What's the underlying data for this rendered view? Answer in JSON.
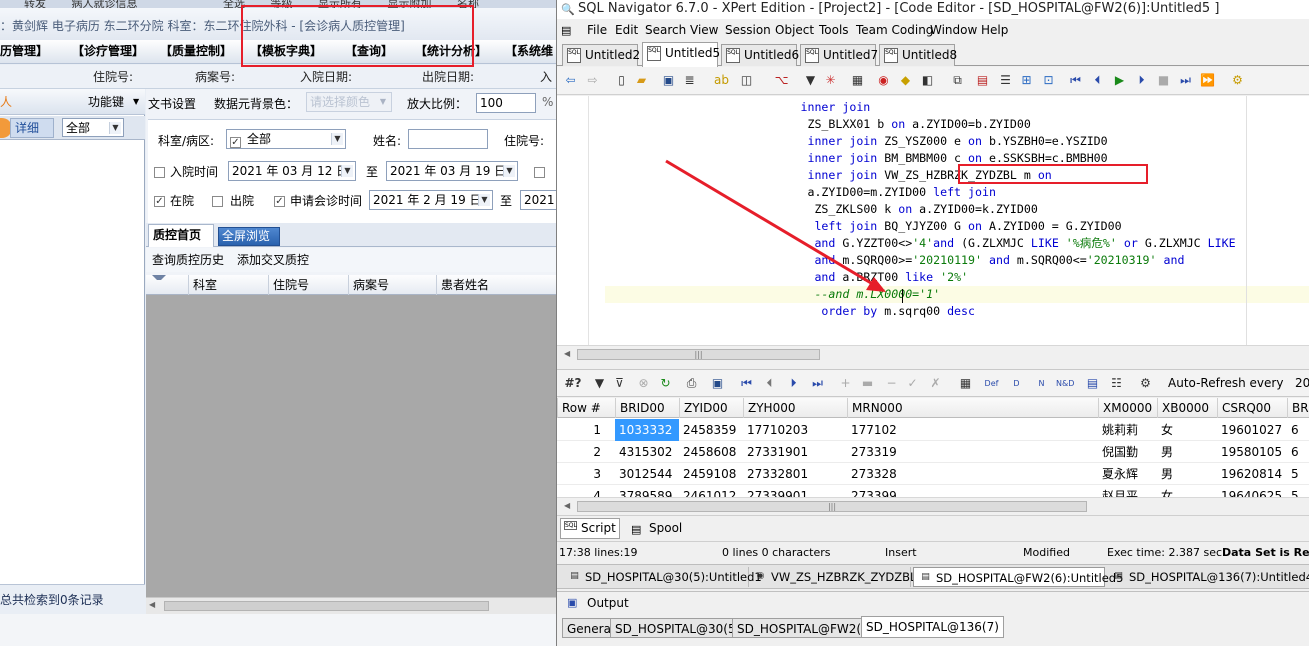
{
  "left_app": {
    "top_strip": [
      "转发",
      "病人就诊信息",
      "全选",
      "等级",
      "显示所有",
      "显示附加",
      "名称"
    ],
    "info": "：黄剑辉 电子病历  东二环分院  科室：东二环住院外科 - [会诊病人质控管理]",
    "menu": [
      "历管理】",
      "【诊疗管理】",
      "【质量控制】",
      "【模板字典】",
      "【查询】",
      "【统计分析】",
      "【系统维"
    ],
    "header_fields": [
      "住院号:",
      "病案号:",
      "入院日期:",
      "出院日期:",
      "入"
    ],
    "side": {
      "label_fragment": "人",
      "function_key": "功能键",
      "tab_detail": "详细",
      "filter_value": "全部",
      "footer": "总共检索到0条记录"
    },
    "settings": {
      "doc_settings": "文书设置",
      "bg_color_label": "数据元背景色：",
      "bg_color_value": "请选择颜色",
      "zoom_label": "放大比例：",
      "zoom_value": "100"
    },
    "filters": {
      "dept_label": "科室/病区:",
      "dept_value": "全部",
      "name_label": "姓名:",
      "inpatient_label": "住院号:",
      "admit_time_label": "入院时间",
      "admit_from": "2021 年 03 月 12 日",
      "to_label": "至",
      "admit_to": "2021 年 03 月 19 日",
      "in_hospital": "在院",
      "discharged": "出院",
      "consult_time_label": "申请会诊时间",
      "consult_from": "2021 年 2 月 19 日",
      "to_label2": "至",
      "consult_to": "2021"
    },
    "tabs": {
      "qc_home": "质控首页",
      "fullscreen": "全屏浏览"
    },
    "actions": {
      "history": "查询质控历史",
      "add_cross": "添加交叉质控"
    },
    "grid_columns": [
      "科室",
      "住院号",
      "病案号",
      "患者姓名"
    ]
  },
  "right_app": {
    "title": "SQL Navigator 6.7.0 - XPert Edition - [Project2] - [Code Editor - [SD_HOSPITAL@FW2(6)]:Untitled5 ]",
    "menu": [
      "File",
      "Edit",
      "Search",
      "View",
      "Session",
      "Object",
      "Tools",
      "Team Coding",
      "Window",
      "Help"
    ],
    "editor_tabs": [
      "Untitled2",
      "Untitled5",
      "Untitled6",
      "Untitled7",
      "Untitled8"
    ],
    "active_tab": "Untitled5",
    "code_lines": [
      {
        "indent": "             ",
        "parts": [
          [
            "kw",
            "inner join"
          ]
        ]
      },
      {
        "indent": "              ",
        "parts": [
          [
            "t",
            "ZS_BLXX01 b "
          ],
          [
            "kw",
            "on"
          ],
          [
            "t",
            " a.ZYID00=b.ZYID00"
          ]
        ]
      },
      {
        "indent": "              ",
        "parts": [
          [
            "kw",
            "inner join"
          ],
          [
            "t",
            " ZS_YSZ000 e "
          ],
          [
            "kw",
            "on"
          ],
          [
            "t",
            " b.YSZBH0=e.YSZID0"
          ]
        ]
      },
      {
        "indent": "              ",
        "parts": [
          [
            "kw",
            "inner join"
          ],
          [
            "t",
            " BM_BMBM00 c "
          ],
          [
            "kw",
            "on"
          ],
          [
            "t",
            " e.SSKSBH=c.BMBH00"
          ]
        ]
      },
      {
        "indent": "              ",
        "parts": [
          [
            "kw",
            "inner join"
          ],
          [
            "t",
            " VW_ZS_HZBRZK_ZYDZBL m "
          ],
          [
            "kw",
            "on"
          ]
        ]
      },
      {
        "indent": "              ",
        "parts": [
          [
            "t",
            "a.ZYID00=m.ZYID00 "
          ],
          [
            "kw",
            "left join"
          ]
        ]
      },
      {
        "indent": "               ",
        "parts": [
          [
            "t",
            "ZS_ZKLS00 k "
          ],
          [
            "kw",
            "on"
          ],
          [
            "t",
            " a.ZYID00=k.ZYID00"
          ]
        ]
      },
      {
        "indent": "               ",
        "parts": [
          [
            "kw",
            "left join"
          ],
          [
            "t",
            " BQ_YJYZ00 G "
          ],
          [
            "kw",
            "on"
          ],
          [
            "t",
            " A.ZYID00 = G.ZYID00"
          ]
        ]
      },
      {
        "indent": "               ",
        "parts": [
          [
            "kw",
            "and"
          ],
          [
            "t",
            " G.YZZT00<>"
          ],
          [
            "str",
            "'4'"
          ],
          [
            "kw",
            "and"
          ],
          [
            "t",
            " (G.ZLXMJC "
          ],
          [
            "kw",
            "LIKE"
          ],
          [
            "t",
            " "
          ],
          [
            "str",
            "'%病危%'"
          ],
          [
            "t",
            " "
          ],
          [
            "kw",
            "or"
          ],
          [
            "t",
            " G.ZLXMJC "
          ],
          [
            "kw",
            "LIKE"
          ]
        ]
      },
      {
        "indent": "               ",
        "parts": [
          [
            "kw",
            "and"
          ],
          [
            "t",
            " m.SQRQ00>="
          ],
          [
            "str",
            "'20210119'"
          ],
          [
            "t",
            " "
          ],
          [
            "kw",
            "and"
          ],
          [
            "t",
            " m.SQRQ00<="
          ],
          [
            "str",
            "'20210319'"
          ],
          [
            "t",
            " "
          ],
          [
            "kw",
            "and"
          ]
        ]
      },
      {
        "indent": "               ",
        "parts": [
          [
            "kw",
            "and"
          ],
          [
            "t",
            " a.BRZT00 "
          ],
          [
            "kw",
            "like"
          ],
          [
            "t",
            " "
          ],
          [
            "str",
            "'2%'"
          ]
        ]
      },
      {
        "indent": "               ",
        "parts": [
          [
            "cm",
            "--and m.LX0000='1'"
          ]
        ]
      },
      {
        "indent": "                ",
        "parts": [
          [
            "kw",
            "order by"
          ],
          [
            "t",
            " m.sqrq00 "
          ],
          [
            "kw",
            "desc"
          ]
        ]
      }
    ],
    "grid_toolbar_label": "#?",
    "auto_refresh": "Auto-Refresh every",
    "auto_refresh_value": "20",
    "grid_columns": [
      "Row #",
      "BRID00",
      "ZYID00",
      "ZYH000",
      "MRN000",
      "XM0000",
      "XB0000",
      "CSRQ00",
      "BR"
    ],
    "grid_rows": [
      [
        "1",
        "1033332",
        "2458359",
        "17710203",
        "177102",
        "姚莉莉",
        "女",
        "19601027",
        "6"
      ],
      [
        "2",
        "4315302",
        "2458608",
        "27331901",
        "273319",
        "倪国勤",
        "男",
        "19580105",
        "6"
      ],
      [
        "3",
        "3012544",
        "2459108",
        "27332801",
        "273328",
        "夏永辉",
        "男",
        "19620814",
        "5"
      ],
      [
        "4",
        "3789589",
        "2461012",
        "27339901",
        "273399",
        "赵月平",
        "女",
        "19640625",
        "5"
      ]
    ],
    "spool_tabs": [
      "Script",
      "Spool"
    ],
    "status": {
      "position": "17:38 lines:19",
      "selection": "0 lines 0 characters",
      "mode": "Insert",
      "modified": "Modified",
      "exec_time": "Exec time: 2.387 sec",
      "dataset": "Data Set is Rea"
    },
    "doc_tabs": [
      "SD_HOSPITAL@30(5):Untitled1",
      "VW_ZS_HZBRZK_ZYDZBL",
      "SD_HOSPITAL@FW2(6):Untitled5",
      "SD_HOSPITAL@136(7):Untitled4"
    ],
    "output_title": "Output",
    "output_tabs": [
      "General",
      "SD_HOSPITAL@30(5)",
      "SD_HOSPITAL@FW2(6)",
      "SD_HOSPITAL@136(7)"
    ]
  },
  "colors": {
    "annotation_red": "#e61e2a",
    "keyword_blue": "#0000d2",
    "string_green": "#0a7a0a",
    "selection_blue": "#3399ff"
  }
}
